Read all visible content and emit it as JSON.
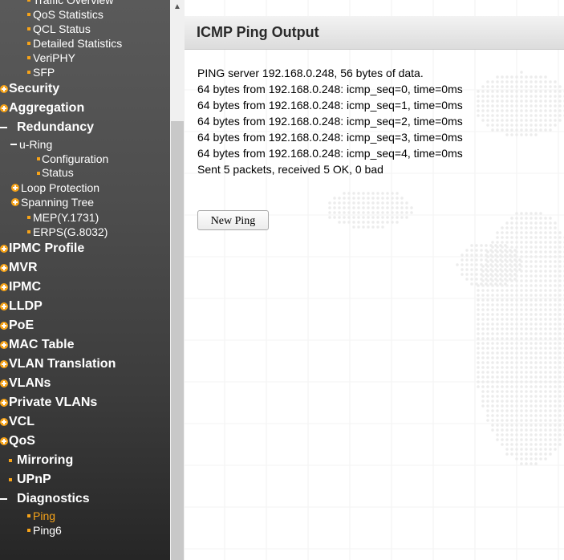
{
  "sidebar": {
    "items": [
      {
        "label": "Traffic Overview",
        "kind": "sub3"
      },
      {
        "label": "QoS Statistics",
        "kind": "sub3"
      },
      {
        "label": "QCL Status",
        "kind": "sub3"
      },
      {
        "label": "Detailed Statistics",
        "kind": "sub3"
      },
      {
        "label": "VeriPHY",
        "kind": "sub3"
      },
      {
        "label": "SFP",
        "kind": "sub3"
      },
      {
        "label": "Security",
        "kind": "top-plus"
      },
      {
        "label": "Aggregation",
        "kind": "top-plus"
      },
      {
        "label": "Redundancy",
        "kind": "top-minus"
      },
      {
        "label": "u-Ring",
        "kind": "sub2-minus"
      },
      {
        "label": "Configuration",
        "kind": "sub3b"
      },
      {
        "label": "Status",
        "kind": "sub3b"
      },
      {
        "label": "Loop Protection",
        "kind": "sub2-plus"
      },
      {
        "label": "Spanning Tree",
        "kind": "sub2-plus"
      },
      {
        "label": "MEP(Y.1731)",
        "kind": "sub2b"
      },
      {
        "label": "ERPS(G.8032)",
        "kind": "sub2b"
      },
      {
        "label": "IPMC Profile",
        "kind": "top-plus"
      },
      {
        "label": "MVR",
        "kind": "top-plus"
      },
      {
        "label": "IPMC",
        "kind": "top-plus"
      },
      {
        "label": "LLDP",
        "kind": "top-plus"
      },
      {
        "label": "PoE",
        "kind": "top-plus"
      },
      {
        "label": "MAC Table",
        "kind": "top-plus"
      },
      {
        "label": "VLAN Translation",
        "kind": "top-plus"
      },
      {
        "label": "VLANs",
        "kind": "top-plus"
      },
      {
        "label": "Private VLANs",
        "kind": "top-plus"
      },
      {
        "label": "VCL",
        "kind": "top-plus"
      },
      {
        "label": "QoS",
        "kind": "top-plus"
      },
      {
        "label": "Mirroring",
        "kind": "top-bullet"
      },
      {
        "label": "UPnP",
        "kind": "top-bullet"
      },
      {
        "label": "Diagnostics",
        "kind": "top-minus"
      },
      {
        "label": "Ping",
        "kind": "sub2b",
        "active": true
      },
      {
        "label": "Ping6",
        "kind": "sub2b"
      }
    ],
    "scroll_up_icon": "up-arrow-icon",
    "accent_color": "#f6a319"
  },
  "main": {
    "title": "ICMP Ping Output",
    "output_lines": [
      "PING server 192.168.0.248, 56 bytes of data.",
      "64 bytes from 192.168.0.248: icmp_seq=0, time=0ms",
      "64 bytes from 192.168.0.248: icmp_seq=1, time=0ms",
      "64 bytes from 192.168.0.248: icmp_seq=2, time=0ms",
      "64 bytes from 192.168.0.248: icmp_seq=3, time=0ms",
      "64 bytes from 192.168.0.248: icmp_seq=4, time=0ms",
      "Sent 5 packets, received 5 OK, 0 bad"
    ],
    "new_ping_label": "New Ping"
  }
}
